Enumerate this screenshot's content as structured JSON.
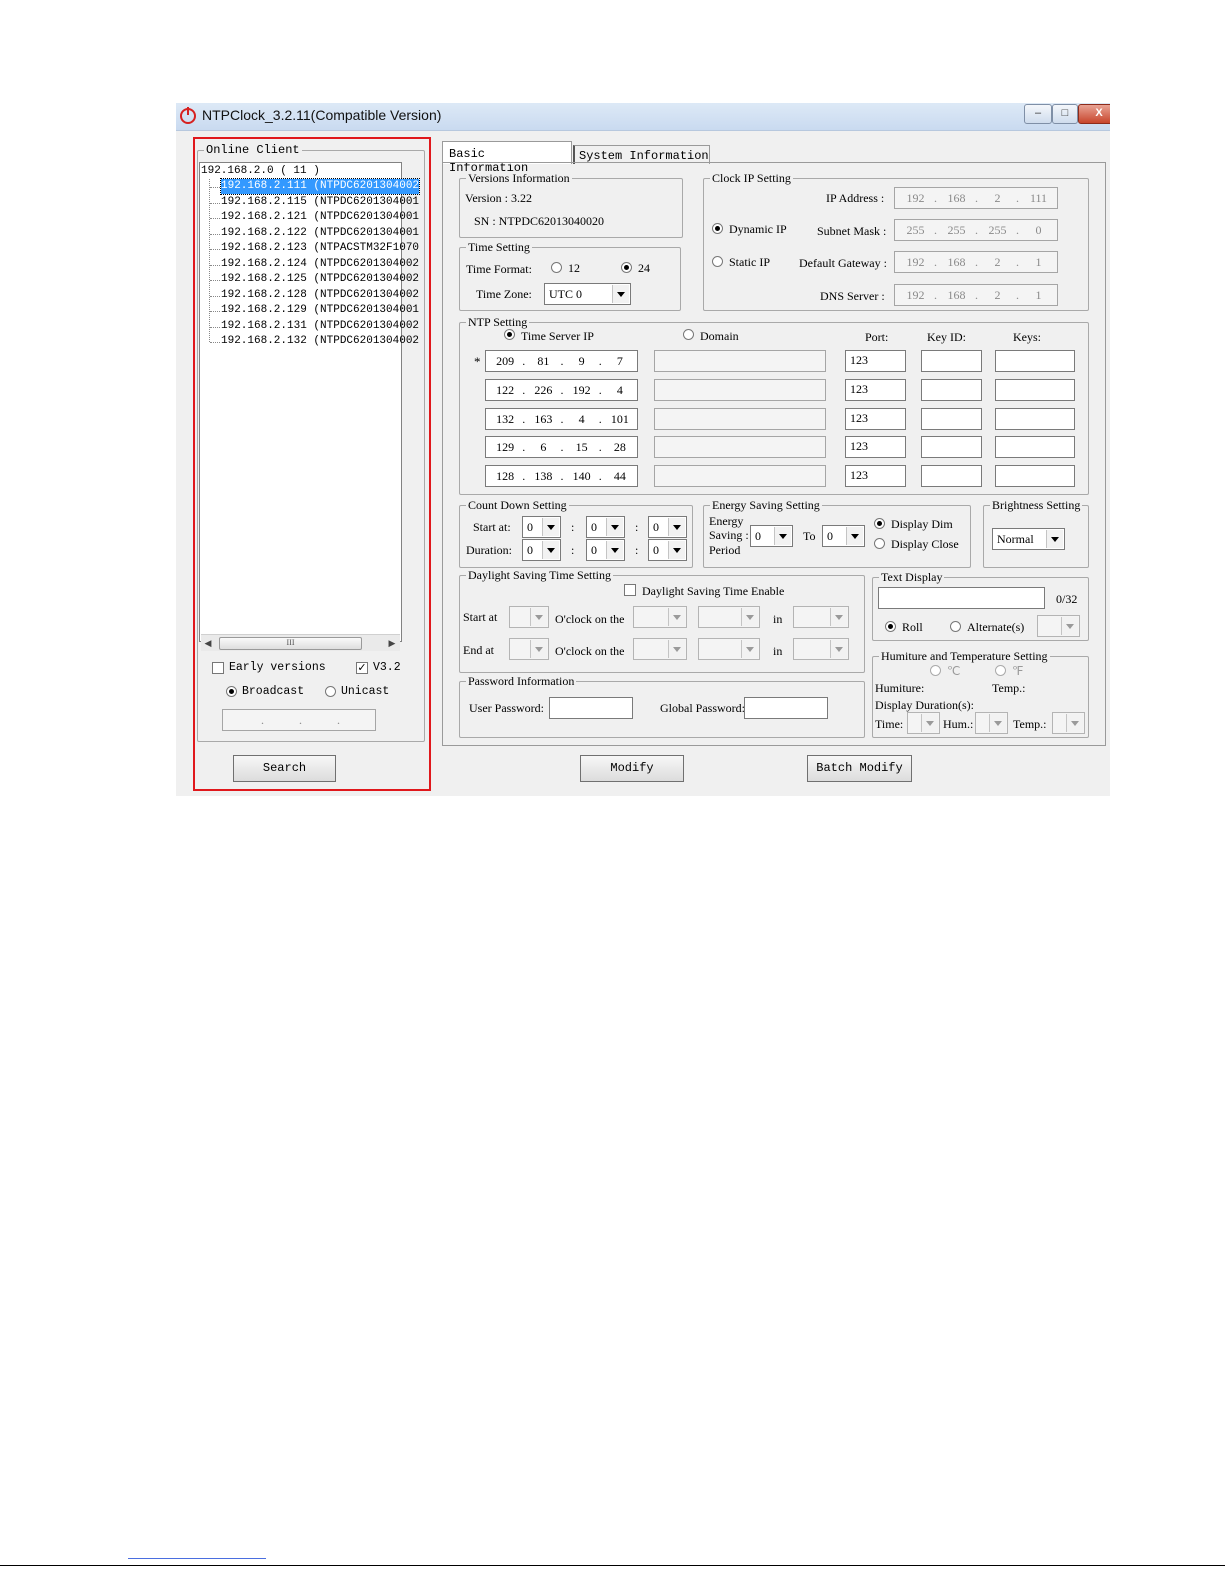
{
  "window": {
    "title": "NTPClock_3.2.11(Compatible Version)",
    "icon": "power-icon",
    "controls": [
      "–",
      "□",
      "X"
    ]
  },
  "left": {
    "group_title": "Online Client",
    "root": "192.168.2.0 ( 11 )",
    "clients": [
      "192.168.2.111 (NTPDC6201304002",
      "192.168.2.115 (NTPDC6201304001",
      "192.168.2.121 (NTPDC6201304001",
      "192.168.2.122 (NTPDC6201304001",
      "192.168.2.123 (NTPACSTM32F1070",
      "192.168.2.124 (NTPDC6201304002",
      "192.168.2.125 (NTPDC6201304002",
      "192.168.2.128 (NTPDC6201304002",
      "192.168.2.129 (NTPDC6201304001",
      "192.168.2.131 (NTPDC6201304002",
      "192.168.2.132 (NTPDC6201304002"
    ],
    "selected_index": 0,
    "scroll_thumb": "III",
    "early_versions": "Early versions",
    "v32": "V3.2",
    "broadcast": "Broadcast",
    "unicast": "Unicast",
    "unicast_ip_dots": [
      ".",
      ".",
      "."
    ],
    "search": "Search"
  },
  "tabs": [
    "Basic Information",
    "System Information"
  ],
  "versions": {
    "title": "Versions Information",
    "version": "Version : 3.22",
    "sn": "SN : NTPDC62013040020"
  },
  "time_setting": {
    "title": "Time Setting",
    "format_label": "Time Format:",
    "opt12": "12",
    "opt24": "24",
    "zone_label": "Time Zone:",
    "zone_value": "UTC 0"
  },
  "clock_ip": {
    "title": "Clock IP Setting",
    "dynamic": "Dynamic IP",
    "static": "Static IP",
    "ip_label": "IP Address :",
    "ip": [
      "192",
      "168",
      "2",
      "111"
    ],
    "mask_label": "Subnet Mask :",
    "mask": [
      "255",
      "255",
      "255",
      "0"
    ],
    "gw_label": "Default Gateway :",
    "gw": [
      "192",
      "168",
      "2",
      "1"
    ],
    "dns_label": "DNS Server :",
    "dns": [
      "192",
      "168",
      "2",
      "1"
    ]
  },
  "ntp": {
    "title": "NTP Setting",
    "server_ip": "Time Server IP",
    "domain": "Domain",
    "port": "Port:",
    "key_id": "Key ID:",
    "keys": "Keys:",
    "star": "*",
    "rows": [
      {
        "ip": [
          "209",
          "81",
          "9",
          "7"
        ],
        "port": "123"
      },
      {
        "ip": [
          "122",
          "226",
          "192",
          "4"
        ],
        "port": "123"
      },
      {
        "ip": [
          "132",
          "163",
          "4",
          "101"
        ],
        "port": "123"
      },
      {
        "ip": [
          "129",
          "6",
          "15",
          "28"
        ],
        "port": "123"
      },
      {
        "ip": [
          "128",
          "138",
          "140",
          "44"
        ],
        "port": "123"
      }
    ]
  },
  "countdown": {
    "title": "Count Down Setting",
    "start": "Start at:",
    "duration": "Duration:",
    "colon": ":",
    "zero": "0"
  },
  "energy": {
    "title": "Energy Saving Setting",
    "label1": "Energy",
    "label2": "Saving :",
    "label3": "Period",
    "to": "To",
    "dim": "Display Dim",
    "close": "Display Close",
    "zero": "0"
  },
  "brightness": {
    "title": "Brightness Setting",
    "value": "Normal"
  },
  "dst": {
    "title": "Daylight Saving Time Setting",
    "enable": "Daylight Saving Time Enable",
    "start": "Start at",
    "end": "End at",
    "oclock": "O'clock on the",
    "in": "in"
  },
  "text_display": {
    "title": "Text Display",
    "count": "0/32",
    "roll": "Roll",
    "alternate": "Alternate(s)"
  },
  "password": {
    "title": "Password Information",
    "user": "User Password:",
    "global": "Global Password:"
  },
  "humiture": {
    "title": "Humiture and Temperature Setting",
    "c": "℃",
    "f": "℉",
    "humiture": "Humiture:",
    "temp": "Temp.:",
    "duration": "Display Duration(s):",
    "time": "Time:",
    "hum": "Hum.:",
    "temp2": "Temp.:"
  },
  "buttons": {
    "modify": "Modify",
    "batch": "Batch Modify"
  }
}
